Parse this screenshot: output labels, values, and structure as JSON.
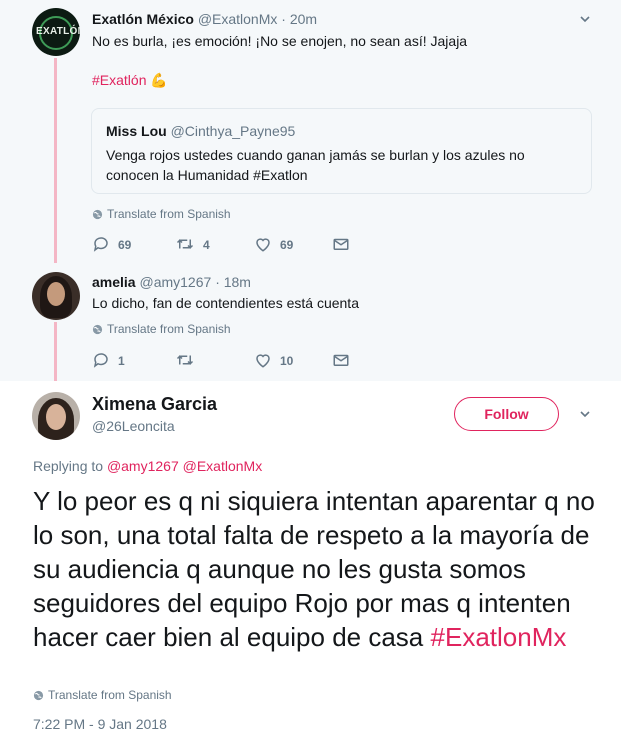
{
  "tweet1": {
    "display_name": "Exatlón México",
    "handle": "@ExatlonMx",
    "time": "· 20m",
    "avatar_text": "EXATLÓN",
    "text": "No es burla, ¡es emoción! ¡No se enojen, no sean así! Jajaja",
    "hashtag": "#Exatlón",
    "emoji": "💪",
    "quote": {
      "display_name": "Miss Lou",
      "handle": "@Cinthya_Payne95",
      "text": "Venga rojos ustedes cuando ganan jamás se burlan y los azules no conocen la Humanidad #Exatlon"
    },
    "translate": "Translate from Spanish",
    "replies": "69",
    "retweets": "4",
    "likes": "69"
  },
  "tweet2": {
    "display_name": "amelia",
    "handle": "@amy1267",
    "time": "· 18m",
    "text": "Lo dicho, fan de contendientes está cuenta",
    "translate": "Translate from Spanish",
    "replies": "1",
    "retweets": "",
    "likes": "10"
  },
  "main": {
    "display_name": "Ximena Garcia",
    "handle": "@26Leoncita",
    "follow_label": "Follow",
    "replying_prefix": "Replying to",
    "replying_users": "@amy1267 @ExatlonMx",
    "text": "Y lo peor es q ni siquiera intentan aparentar q no lo son, una total falta de respeto a la mayoría de su audiencia q aunque no les gusta somos seguidores del equipo Rojo por mas q intenten hacer caer bien al equipo de casa",
    "hashtag": "#ExatlonMx",
    "translate": "Translate from Spanish",
    "timestamp": "7:22 PM - 9 Jan 2018"
  },
  "colors": {
    "accent": "#e0245e",
    "thread_line": "#f4b6c5",
    "muted": "#657786"
  }
}
